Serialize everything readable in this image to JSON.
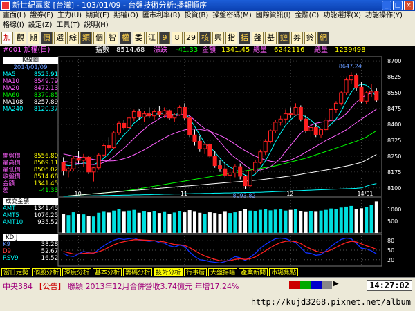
{
  "window": {
    "title": "新世紀贏家 [台灣] - 103/01/09 - 台盤技術分析:播報順序"
  },
  "menu_row1": [
    "畫面(L)",
    "證券(F)",
    "主力(U)",
    "期貨(E)",
    "期權(O)",
    "匯市利率(R)",
    "投資(B)",
    "操盤密碼(M)",
    "國際資訊(I)",
    "金融(C)",
    "功能選擇(X)",
    "功能操作(Y)"
  ],
  "menu_row2": [
    "格線(I)",
    "設定(Z)",
    "工具(T)",
    "說明(H)"
  ],
  "toolbar_buttons": [
    "加",
    "觀",
    "期",
    "價",
    "選",
    "綜",
    "類",
    "個",
    "智",
    "權",
    "委",
    "江",
    "9",
    "8",
    "29",
    "核",
    "興",
    "指",
    "括",
    "盤",
    "基",
    "鏈",
    "券",
    "鈴",
    "網"
  ],
  "info": {
    "stock": "#001 加權(日)",
    "index_label": "指數",
    "index_value": "8514.68",
    "change_label": "漲跌",
    "change_value": "-41.33",
    "amount_label": "金額",
    "amount_value": "1341.45",
    "volume_label": "總量",
    "volume_value": "6242116",
    "total_label": "總量",
    "total_value": "1239498"
  },
  "left_panel": {
    "k_title": "K線圖",
    "date": "2014/01/09",
    "ma": [
      {
        "label": "MA5",
        "value": "8525.91",
        "color": "#00ffff"
      },
      {
        "label": "MA10",
        "value": "8549.79",
        "color": "#ff60ff"
      },
      {
        "label": "MA20",
        "value": "8472.13",
        "color": "#ff60ff"
      },
      {
        "label": "MA60",
        "value": "8370.85",
        "color": "#00ff00"
      },
      {
        "label": "MA108",
        "value": "8257.89",
        "color": "#ffffff"
      },
      {
        "label": "MA240",
        "value": "8120.37",
        "color": "#00ffff"
      }
    ],
    "prices": [
      {
        "label": "開盤價",
        "value": "8556.80"
      },
      {
        "label": "最高價",
        "value": "8569.11"
      },
      {
        "label": "最低價",
        "value": "8506.02"
      },
      {
        "label": "收盤價",
        "value": "8514.68"
      },
      {
        "label": "金額",
        "value": "1341.45"
      },
      {
        "label": "差",
        "value": "-41.33"
      }
    ],
    "vol_title": "成交金額",
    "vol_rows": [
      {
        "label": "AMT",
        "value": "1341.45"
      },
      {
        "label": "AMT5",
        "value": "1076.25"
      },
      {
        "label": "AMT10",
        "value": "935.52"
      }
    ],
    "kd_title": "KD,J",
    "kd_rows": [
      {
        "label": "K9",
        "value": "38.28"
      },
      {
        "label": "D9",
        "value": "52.67"
      },
      {
        "label": "RSV9",
        "value": "16.52"
      }
    ]
  },
  "chart_data": [
    {
      "type": "candlestick",
      "title": "",
      "x_ticks": [
        "10",
        "11",
        "12",
        "14/01"
      ],
      "y_ticks": [
        8700,
        8625,
        8550,
        8475,
        8400,
        8325,
        8250,
        8175,
        8100
      ],
      "ylim": [
        8060,
        8720
      ],
      "annotations": [
        {
          "label": "8647.24",
          "x": 57,
          "y": 8647.24
        },
        {
          "label": "8093.82",
          "x": 36,
          "y": 8093.82
        }
      ],
      "ohlc": [
        [
          8220,
          8245,
          8160,
          8180
        ],
        [
          8180,
          8200,
          8150,
          8190
        ],
        [
          8190,
          8250,
          8180,
          8240
        ],
        [
          8240,
          8275,
          8215,
          8230
        ],
        [
          8230,
          8260,
          8200,
          8245
        ],
        [
          8245,
          8250,
          8165,
          8175
        ],
        [
          8175,
          8200,
          8130,
          8195
        ],
        [
          8195,
          8265,
          8185,
          8255
        ],
        [
          8255,
          8310,
          8245,
          8300
        ],
        [
          8300,
          8340,
          8280,
          8290
        ],
        [
          8290,
          8370,
          8285,
          8360
        ],
        [
          8360,
          8415,
          8350,
          8405
        ],
        [
          8405,
          8420,
          8375,
          8385
        ],
        [
          8385,
          8440,
          8370,
          8430
        ],
        [
          8430,
          8470,
          8415,
          8460
        ],
        [
          8460,
          8475,
          8420,
          8435
        ],
        [
          8435,
          8465,
          8410,
          8450
        ],
        [
          8450,
          8480,
          8430,
          8440
        ],
        [
          8440,
          8470,
          8420,
          8460
        ],
        [
          8460,
          8485,
          8435,
          8445
        ],
        [
          8445,
          8480,
          8430,
          8465
        ],
        [
          8465,
          8470,
          8420,
          8430
        ],
        [
          8430,
          8455,
          8410,
          8445
        ],
        [
          8445,
          8490,
          8440,
          8480
        ],
        [
          8480,
          8500,
          8420,
          8430
        ],
        [
          8430,
          8440,
          8340,
          8350
        ],
        [
          8350,
          8375,
          8300,
          8320
        ],
        [
          8320,
          8345,
          8270,
          8285
        ],
        [
          8285,
          8320,
          8260,
          8305
        ],
        [
          8305,
          8310,
          8240,
          8250
        ],
        [
          8250,
          8275,
          8195,
          8205
        ],
        [
          8205,
          8230,
          8175,
          8190
        ],
        [
          8190,
          8220,
          8150,
          8160
        ],
        [
          8160,
          8195,
          8120,
          8170
        ],
        [
          8170,
          8210,
          8150,
          8200
        ],
        [
          8200,
          8215,
          8140,
          8155
        ],
        [
          8155,
          8160,
          8093.82,
          8110
        ],
        [
          8110,
          8190,
          8105,
          8180
        ],
        [
          8180,
          8230,
          8170,
          8220
        ],
        [
          8220,
          8280,
          8210,
          8270
        ],
        [
          8270,
          8330,
          8255,
          8320
        ],
        [
          8320,
          8380,
          8310,
          8370
        ],
        [
          8370,
          8420,
          8360,
          8410
        ],
        [
          8410,
          8440,
          8395,
          8425
        ],
        [
          8425,
          8470,
          8405,
          8450
        ],
        [
          8450,
          8480,
          8430,
          8445
        ],
        [
          8445,
          8500,
          8440,
          8480
        ],
        [
          8480,
          8490,
          8415,
          8425
        ],
        [
          8425,
          8445,
          8360,
          8370
        ],
        [
          8370,
          8395,
          8340,
          8385
        ],
        [
          8385,
          8400,
          8340,
          8350
        ],
        [
          8350,
          8380,
          8335,
          8375
        ],
        [
          8375,
          8430,
          8365,
          8420
        ],
        [
          8420,
          8480,
          8410,
          8470
        ],
        [
          8470,
          8510,
          8455,
          8500
        ],
        [
          8500,
          8560,
          8490,
          8550
        ],
        [
          8550,
          8620,
          8540,
          8610
        ],
        [
          8610,
          8647.24,
          8590,
          8630
        ],
        [
          8630,
          8640,
          8560,
          8575
        ],
        [
          8575,
          8600,
          8500,
          8510
        ],
        [
          8510,
          8560,
          8495,
          8550
        ],
        [
          8550,
          8590,
          8530,
          8556
        ],
        [
          8556.8,
          8569.11,
          8506.02,
          8514.68
        ]
      ],
      "ma_lines": [
        {
          "name": "MA5",
          "color": "#00ffff",
          "values": [
            8210,
            8205,
            8208,
            8212,
            8218,
            8215,
            8210,
            8222,
            8240,
            8262,
            8290,
            8322,
            8350,
            8375,
            8406,
            8425,
            8437,
            8445,
            8448,
            8450,
            8452,
            8450,
            8445,
            8452,
            8455,
            8428,
            8390,
            8350,
            8310,
            8295,
            8268,
            8240,
            8215,
            8198,
            8186,
            8175,
            8160,
            8152,
            8165,
            8192,
            8228,
            8270,
            8318,
            8358,
            8395,
            8422,
            8442,
            8448,
            8436,
            8420,
            8398,
            8378,
            8380,
            8400,
            8425,
            8462,
            8510,
            8552,
            8580,
            8590,
            8585,
            8565,
            8526
          ]
        },
        {
          "name": "MA10",
          "color": "#ff60ff",
          "values": [
            8225,
            8222,
            8218,
            8215,
            8213,
            8212,
            8210,
            8213,
            8220,
            8232,
            8248,
            8268,
            8288,
            8310,
            8334,
            8356,
            8378,
            8398,
            8412,
            8428,
            8438,
            8440,
            8440,
            8444,
            8448,
            8440,
            8420,
            8398,
            8380,
            8370,
            8345,
            8318,
            8290,
            8262,
            8242,
            8225,
            8205,
            8190,
            8184,
            8184,
            8190,
            8200,
            8218,
            8240,
            8272,
            8300,
            8330,
            8358,
            8378,
            8395,
            8405,
            8410,
            8414,
            8418,
            8420,
            8430,
            8450,
            8478,
            8505,
            8525,
            8540,
            8548,
            8550
          ]
        },
        {
          "name": "MA20",
          "color": "#ff60ff",
          "values": [
            8260,
            8255,
            8250,
            8246,
            8242,
            8238,
            8234,
            8230,
            8228,
            8227,
            8228,
            8232,
            8238,
            8246,
            8256,
            8268,
            8280,
            8294,
            8308,
            8322,
            8336,
            8348,
            8358,
            8366,
            8374,
            8378,
            8378,
            8376,
            8372,
            8366,
            8358,
            8348,
            8336,
            8322,
            8306,
            8290,
            8276,
            8262,
            8250,
            8240,
            8232,
            8226,
            8222,
            8222,
            8226,
            8232,
            8242,
            8254,
            8268,
            8282,
            8296,
            8310,
            8324,
            8336,
            8348,
            8360,
            8374,
            8390,
            8408,
            8424,
            8440,
            8456,
            8472
          ]
        },
        {
          "name": "MA60",
          "color": "#00ff00",
          "values": [
            8060,
            8062,
            8064,
            8066,
            8068,
            8070,
            8072,
            8074,
            8076,
            8078,
            8080,
            8082,
            8085,
            8088,
            8092,
            8096,
            8100,
            8104,
            8108,
            8112,
            8116,
            8120,
            8124,
            8128,
            8132,
            8136,
            8140,
            8144,
            8148,
            8152,
            8156,
            8160,
            8164,
            8168,
            8172,
            8176,
            8180,
            8184,
            8188,
            8192,
            8196,
            8200,
            8204,
            8210,
            8216,
            8222,
            8228,
            8234,
            8240,
            8248,
            8256,
            8264,
            8272,
            8280,
            8288,
            8296,
            8304,
            8312,
            8320,
            8330,
            8340,
            8355,
            8370
          ]
        },
        {
          "name": "MA108",
          "color": "#ffffff",
          "values": [
            8060,
            8062,
            8064,
            8066,
            8068,
            8070,
            8072,
            8074,
            8076,
            8078,
            8080,
            8082,
            8084,
            8086,
            8088,
            8090,
            8092,
            8094,
            8096,
            8098,
            8100,
            8102,
            8104,
            8106,
            8108,
            8110,
            8112,
            8114,
            8116,
            8118,
            8120,
            8122,
            8124,
            8126,
            8128,
            8130,
            8132,
            8134,
            8136,
            8138,
            8141,
            8144,
            8147,
            8150,
            8153,
            8156,
            8160,
            8164,
            8168,
            8172,
            8176,
            8180,
            8184,
            8188,
            8193,
            8198,
            8203,
            8208,
            8214,
            8220,
            8232,
            8245,
            8258
          ]
        },
        {
          "name": "MA240",
          "color": "#00ffff",
          "values": [
            8060,
            8060,
            8061,
            8061,
            8062,
            8062,
            8063,
            8063,
            8064,
            8064,
            8065,
            8065,
            8066,
            8066,
            8067,
            8067,
            8068,
            8068,
            8069,
            8069,
            8070,
            8070,
            8071,
            8071,
            8072,
            8072,
            8073,
            8073,
            8074,
            8074,
            8075,
            8075,
            8076,
            8076,
            8077,
            8077,
            8078,
            8078,
            8079,
            8079,
            8080,
            8081,
            8082,
            8083,
            8084,
            8085,
            8086,
            8087,
            8088,
            8089,
            8090,
            8091,
            8092,
            8093,
            8094,
            8095,
            8096,
            8097,
            8098,
            8100,
            8108,
            8115,
            8120
          ]
        }
      ]
    },
    {
      "type": "bar",
      "title": "成交金額",
      "y_ticks": [
        1000,
        500
      ],
      "ylim": [
        0,
        1500
      ],
      "values": [
        810,
        760,
        880,
        820,
        790,
        730,
        700,
        860,
        900,
        870,
        950,
        1020,
        900,
        950,
        980,
        860,
        910,
        880,
        930,
        850,
        890,
        820,
        870,
        930,
        880,
        970,
        900,
        860,
        820,
        880,
        850,
        800,
        900,
        850,
        880,
        930,
        1000,
        950,
        920,
        980,
        1010,
        960,
        990,
        1030,
        950,
        980,
        1020,
        930,
        890,
        940,
        900,
        950,
        980,
        1040,
        1000,
        1080,
        1120,
        1150,
        1020,
        1050,
        1090,
        1180,
        1341.45
      ]
    },
    {
      "type": "line",
      "title": "KD,J",
      "y_ticks": [
        80,
        50,
        20
      ],
      "ylim": [
        0,
        100
      ],
      "series": [
        {
          "name": "K9",
          "color": "#1030ff",
          "values": [
            40,
            32,
            30,
            38,
            46,
            42,
            40,
            52,
            64,
            74,
            82,
            86,
            84,
            86,
            88,
            82,
            80,
            78,
            80,
            74,
            72,
            64,
            60,
            66,
            62,
            44,
            30,
            20,
            18,
            14,
            12,
            10,
            14,
            20,
            30,
            26,
            18,
            28,
            40,
            56,
            68,
            78,
            86,
            88,
            86,
            80,
            74,
            58,
            42,
            40,
            34,
            36,
            48,
            62,
            74,
            84,
            88,
            86,
            72,
            56,
            54,
            48,
            38.28
          ]
        },
        {
          "name": "D9",
          "color": "#ff2020",
          "values": [
            46,
            42,
            38,
            38,
            40,
            41,
            41,
            45,
            51,
            59,
            67,
            73,
            77,
            80,
            83,
            83,
            82,
            81,
            80,
            78,
            76,
            72,
            68,
            67,
            65,
            58,
            49,
            39,
            32,
            26,
            21,
            17,
            16,
            17,
            21,
            23,
            21,
            23,
            29,
            38,
            48,
            58,
            67,
            74,
            78,
            79,
            77,
            71,
            61,
            54,
            47,
            43,
            45,
            51,
            59,
            67,
            74,
            78,
            76,
            70,
            64,
            59,
            52.67
          ]
        }
      ]
    }
  ],
  "tabs": [
    "當日走勢",
    "個股分析",
    "深度分析",
    "基本分析",
    "籌碼分析",
    "技術分析",
    "行事曆",
    "大盤掃瞄",
    "產業新聞",
    "市場焦點"
  ],
  "active_tab": "技術分析",
  "news": {
    "code": "中央384",
    "label": "【公告】",
    "text": "聯穎 2013年12月合併營收3.74億元 年增17.24%"
  },
  "clock": "14:27:02",
  "url": "http://kujd3268.pixnet.net/album"
}
